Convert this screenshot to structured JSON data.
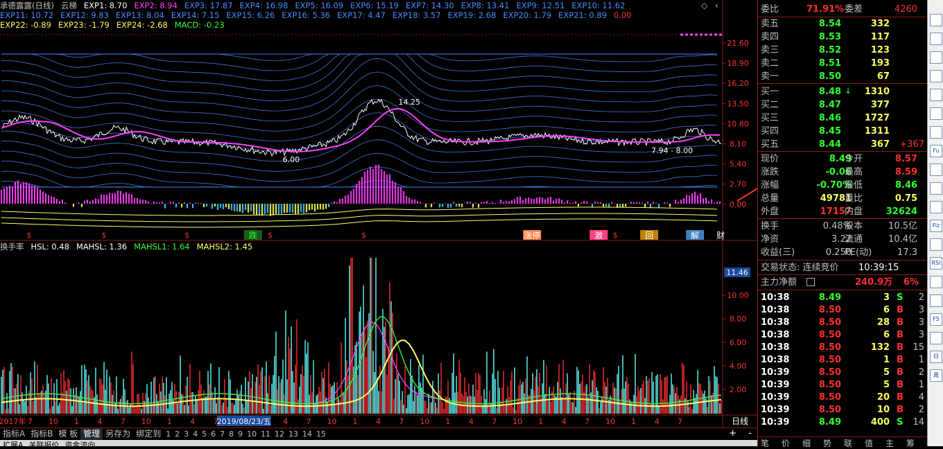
{
  "legend": {
    "row1": [
      {
        "t": "承德露露(日线)",
        "c": "#c0c0c0"
      },
      {
        "t": "云梯",
        "c": "#c0c0c0"
      },
      {
        "t": "EXP1: 8.70",
        "c": "#ffffff"
      },
      {
        "t": "EXP2: 8.94",
        "c": "#ff40ff"
      },
      {
        "t": "EXP3: 17.87",
        "c": "#4a8cff"
      },
      {
        "t": "EXP4: 16.98",
        "c": "#4a8cff"
      },
      {
        "t": "EXP5: 16.09",
        "c": "#4a8cff"
      },
      {
        "t": "EXP6: 15.19",
        "c": "#4a8cff"
      },
      {
        "t": "EXP7: 14.30",
        "c": "#4a8cff"
      },
      {
        "t": "EXP8: 13.41",
        "c": "#4a8cff"
      },
      {
        "t": "EXP9: 12.51",
        "c": "#4a8cff"
      },
      {
        "t": "EXP10: 11.62",
        "c": "#4a8cff"
      }
    ],
    "row2": [
      {
        "t": "EXP11: 10.72",
        "c": "#4a8cff"
      },
      {
        "t": "EXP12: 9.83",
        "c": "#4a8cff"
      },
      {
        "t": "EXP13: 8.04",
        "c": "#4a8cff"
      },
      {
        "t": "EXP14: 7.15",
        "c": "#4a8cff"
      },
      {
        "t": "EXP15: 6.26",
        "c": "#4a8cff"
      },
      {
        "t": "EXP16: 5.36",
        "c": "#4a8cff"
      },
      {
        "t": "EXP17: 4.47",
        "c": "#4a8cff"
      },
      {
        "t": "EXP18: 3.57",
        "c": "#4a8cff"
      },
      {
        "t": "EXP19: 2.68",
        "c": "#4a8cff"
      },
      {
        "t": "EXP20: 1.79",
        "c": "#4a8cff"
      },
      {
        "t": "EXP21: 0.89",
        "c": "#4a8cff"
      },
      {
        "t": "0.00",
        "c": "#ff3030"
      }
    ],
    "row3": [
      {
        "t": "EXP22: -0.89",
        "c": "#ffff60"
      },
      {
        "t": "EXP23: -1.79",
        "c": "#ffff60"
      },
      {
        "t": "EXP24: -2.68",
        "c": "#ffff60"
      },
      {
        "t": "MACD: -0.23",
        "c": "#30ff30"
      }
    ],
    "row4": [
      {
        "t": "换手率",
        "c": "#c0c0c0"
      },
      {
        "t": "HSL: 0.48",
        "c": "#ffffff"
      },
      {
        "t": "MAHSL: 1.36",
        "c": "#ffffff"
      },
      {
        "t": "MAHSL1: 1.64",
        "c": "#30ff30"
      },
      {
        "t": "MAHSL2: 1.45",
        "c": "#ffff60"
      }
    ]
  },
  "price_axis": [
    "21.60",
    "18.90",
    "16.20",
    "13.50",
    "10.80",
    "8.10",
    "5.40",
    "2.70",
    "0.00"
  ],
  "vol_axis": [
    "10.00",
    "8.00",
    "6.00",
    "4.00",
    "2.00"
  ],
  "vol_cursor_value": "11.46",
  "annotations": {
    "high": "14.25",
    "low1": "6.00",
    "low2": "7.94 - 8.00"
  },
  "event_labels": [
    "跌",
    "涨停",
    "激",
    "回",
    "解",
    "财"
  ],
  "date_axis": {
    "labels": [
      "2017年",
      "7",
      "10",
      "1",
      "4",
      "7",
      "10",
      "1",
      "4",
      "7",
      "10",
      "1",
      "4",
      "7",
      "10",
      "1",
      "4",
      "7",
      "10",
      "1",
      "4",
      "7",
      "10",
      "1",
      "4",
      "7",
      "10",
      "1",
      "4",
      "7"
    ],
    "cursor": "2019/08/23/五",
    "period": "日线"
  },
  "tabs": [
    "指标A",
    "指标B",
    "模 板",
    "管理",
    "另存为",
    "绑定到",
    "1",
    "2",
    "3",
    "4",
    "5",
    "6",
    "7",
    "8",
    "9",
    "10",
    "11",
    "12",
    "13",
    "14",
    "15"
  ],
  "status_items": [
    "扩展A",
    "关联报价",
    "资金流向"
  ],
  "order_book": {
    "weibi_label": "委比",
    "weibi_val": "71.91%",
    "weicha_label": "委差",
    "weicha_val": "4260",
    "asks": [
      {
        "l": "卖五",
        "p": "8.54",
        "v": "332"
      },
      {
        "l": "卖四",
        "p": "8.53",
        "v": "117"
      },
      {
        "l": "卖三",
        "p": "8.52",
        "v": "123"
      },
      {
        "l": "卖二",
        "p": "8.51",
        "v": "193"
      },
      {
        "l": "卖一",
        "p": "8.50",
        "v": "67"
      }
    ],
    "bids": [
      {
        "l": "买一",
        "p": "8.48",
        "v": "1310",
        "x": ""
      },
      {
        "l": "买二",
        "p": "8.47",
        "v": "377",
        "x": ""
      },
      {
        "l": "买三",
        "p": "8.46",
        "v": "1727",
        "x": ""
      },
      {
        "l": "买四",
        "p": "8.45",
        "v": "1311",
        "x": ""
      },
      {
        "l": "买五",
        "p": "8.44",
        "v": "367",
        "x": "+367"
      }
    ]
  },
  "quote": [
    {
      "a": "现价",
      "av": "8.49",
      "ac": "#30ff30",
      "b": "今开",
      "bv": "8.57",
      "bc": "#ff3030"
    },
    {
      "a": "涨跌",
      "av": "-0.06",
      "ac": "#30ff30",
      "b": "最高",
      "bv": "8.59",
      "bc": "#ff3030"
    },
    {
      "a": "涨幅",
      "av": "-0.70%",
      "ac": "#30ff30",
      "b": "最低",
      "bv": "8.46",
      "bc": "#30ff30"
    },
    {
      "a": "总量",
      "av": "49781",
      "ac": "#ffff60",
      "b": "量比",
      "bv": "0.75",
      "bc": "#ffff60"
    },
    {
      "a": "外盘",
      "av": "17157",
      "ac": "#ff3030",
      "b": "内盘",
      "bv": "32624",
      "bc": "#30ff30"
    }
  ],
  "fundamentals": [
    {
      "a": "换手",
      "av": "0.48%",
      "b": "股本",
      "bv": "10.5亿"
    },
    {
      "a": "净资",
      "av": "3.22",
      "b": "流通",
      "bv": "10.4亿"
    },
    {
      "a": "收益(三)",
      "av": "0.250",
      "b": "PE(动)",
      "bv": "17.3"
    }
  ],
  "trade_state": {
    "label": "交易状态: 连续竞价",
    "time": "10:39:15"
  },
  "main_flow": {
    "label": "主力净额",
    "value": "240.9万",
    "pct": "6%"
  },
  "ticks": [
    {
      "t": "10:38",
      "p": "8.49",
      "v": "3",
      "s": "S",
      "n": "2"
    },
    {
      "t": "10:38",
      "p": "8.50",
      "v": "6",
      "s": "B",
      "n": "3"
    },
    {
      "t": "10:38",
      "p": "8.50",
      "v": "28",
      "s": "B",
      "n": "3"
    },
    {
      "t": "10:38",
      "p": "8.50",
      "v": "6",
      "s": "B",
      "n": "3"
    },
    {
      "t": "10:38",
      "p": "8.50",
      "v": "132",
      "s": "B",
      "n": "15"
    },
    {
      "t": "10:38",
      "p": "8.50",
      "v": "1",
      "s": "B",
      "n": "1"
    },
    {
      "t": "10:39",
      "p": "8.50",
      "v": "5",
      "s": "B",
      "n": "2"
    },
    {
      "t": "10:39",
      "p": "8.50",
      "v": "5",
      "s": "B",
      "n": "1"
    },
    {
      "t": "10:39",
      "p": "8.50",
      "v": "20",
      "s": "B",
      "n": "4"
    },
    {
      "t": "10:39",
      "p": "8.50",
      "v": "10",
      "s": "B",
      "n": "2"
    },
    {
      "t": "10:39",
      "p": "8.49",
      "v": "400",
      "s": "S",
      "n": "14"
    }
  ],
  "right_tabs": [
    "笔",
    "价",
    "细",
    "势",
    "联",
    "值",
    "主",
    "筹"
  ],
  "toolbar_icons": [
    "chart-icon",
    "list-icon",
    "grid-icon",
    "table-icon",
    "news-icon",
    "bar-icon",
    "flow-icon",
    "f10-icon",
    "info-icon",
    "compare-icon",
    "tools-icon",
    "kline-icon",
    "macd-icon",
    "rsi-icon",
    "move-icon",
    "pen-icon",
    "f5-icon",
    "page-icon",
    "day-icon",
    "week-icon"
  ],
  "toolbar_labels": [
    "",
    "",
    "",
    "",
    "",
    "",
    "",
    "Fu",
    "",
    "",
    "",
    "Fiz",
    "",
    "RSI",
    "",
    "",
    "F5",
    "",
    "日",
    "周"
  ],
  "colors": {
    "up": "#ff3030",
    "down": "#30ff30",
    "frame": "#8b1a1a",
    "band": "#4a8cff",
    "ma": "#ff40ff",
    "volume": "#ffff60"
  }
}
